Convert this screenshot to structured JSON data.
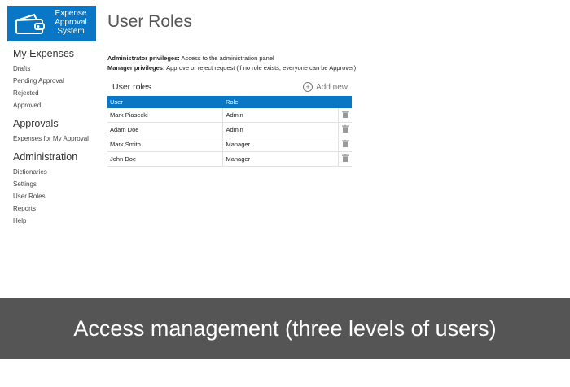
{
  "logo": {
    "line1": "Expense",
    "line2": "Approval",
    "line3": "System",
    "icon": "wallet-icon"
  },
  "sidebar": {
    "sections": [
      {
        "title": "My Expenses",
        "items": [
          "Drafts",
          "Pending Approval",
          "Rejected",
          "Approved"
        ]
      },
      {
        "title": "Approvals",
        "items": [
          "Expenses for My Approval"
        ]
      },
      {
        "title": "Administration",
        "items": [
          "Dictionaries",
          "Settings",
          "User Roles",
          "Reports",
          "Help"
        ]
      }
    ]
  },
  "page": {
    "title": "User Roles",
    "admin_label": "Administrator privileges:",
    "admin_text": "Access to the administration panel",
    "manager_label": "Manager privileges:",
    "manager_text": "Approve or reject request (if no role exists, everyone can be Approver)"
  },
  "roles": {
    "title": "User roles",
    "add_new": "Add new",
    "columns": [
      "User",
      "Role"
    ],
    "rows": [
      {
        "user": "Mark Piasecki",
        "role": "Admin"
      },
      {
        "user": "Adam Doe",
        "role": "Admin"
      },
      {
        "user": "Mark Smith",
        "role": "Manager"
      },
      {
        "user": "John Doe",
        "role": "Manager"
      }
    ]
  },
  "banner": {
    "text": "Access management (three levels of users)"
  },
  "colors": {
    "accent": "#0a77c6",
    "banner_bg": "#555555"
  }
}
